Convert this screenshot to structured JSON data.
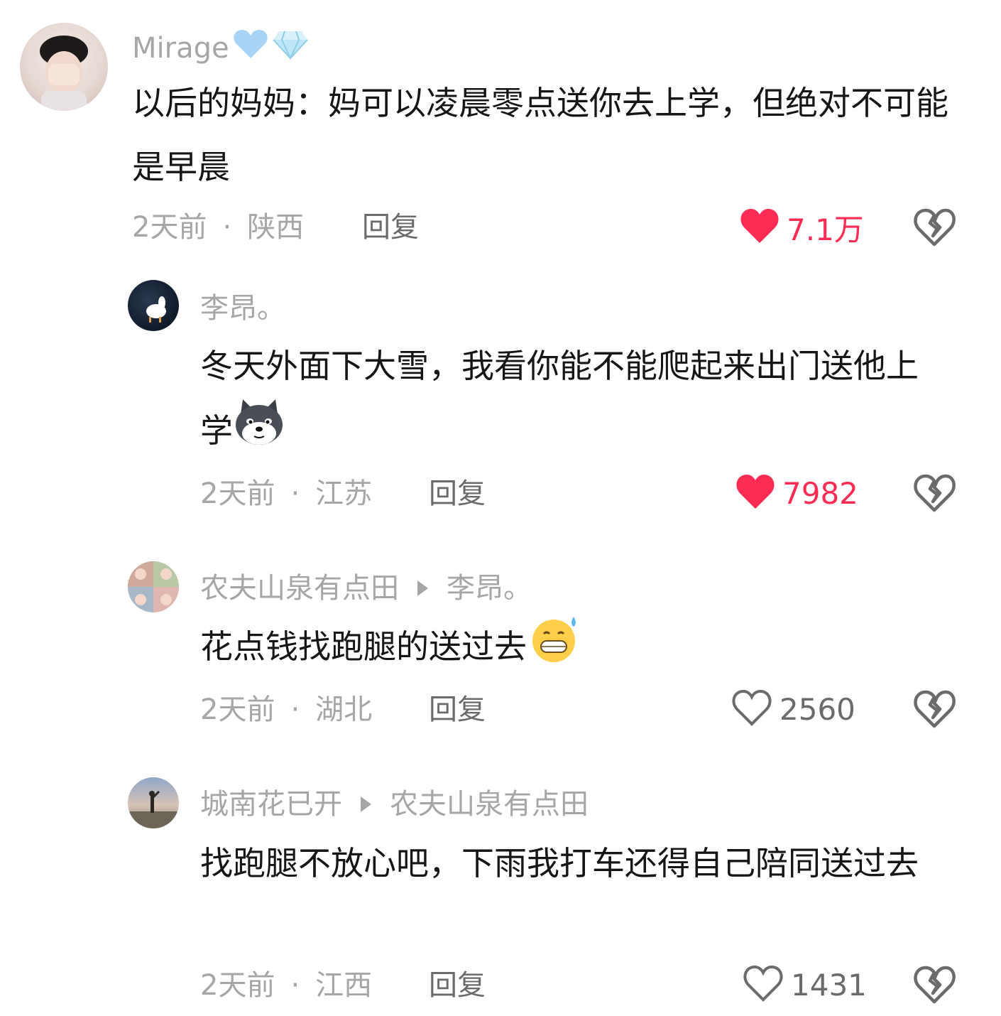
{
  "comments": [
    {
      "username": "Mirage",
      "badges": [
        "blue-heart-icon",
        "diamond-icon"
      ],
      "text": "以后的妈妈：妈可以凌晨零点送你去上学，但绝对不可能是早晨",
      "time": "2天前",
      "location": "陕西",
      "reply_label": "回复",
      "likes": "7.1万",
      "liked": true
    },
    {
      "username": "李昂。",
      "text": "冬天外面下大雪，我看你能不能爬起来出门送他上学",
      "emoji": "husky-dog-emoji",
      "time": "2天前",
      "location": "江苏",
      "reply_label": "回复",
      "likes": "7982",
      "liked": true
    },
    {
      "username": "农夫山泉有点田",
      "reply_to": "李昂。",
      "text": "花点钱找跑腿的送过去",
      "emoji": "grinning-sweat-emoji",
      "time": "2天前",
      "location": "湖北",
      "reply_label": "回复",
      "likes": "2560",
      "liked": false
    },
    {
      "username": "城南花已开",
      "reply_to": "农夫山泉有点田",
      "text": "找跑腿不放心吧，下雨我打车还得自己陪同送过去",
      "time": "2天前",
      "location": "江西",
      "reply_label": "回复",
      "likes": "1431",
      "liked": false
    }
  ],
  "colors": {
    "like_active": "#fe2c55",
    "secondary_text": "#a6a6a6",
    "primary_text": "#161616"
  },
  "separator_dot": "·"
}
